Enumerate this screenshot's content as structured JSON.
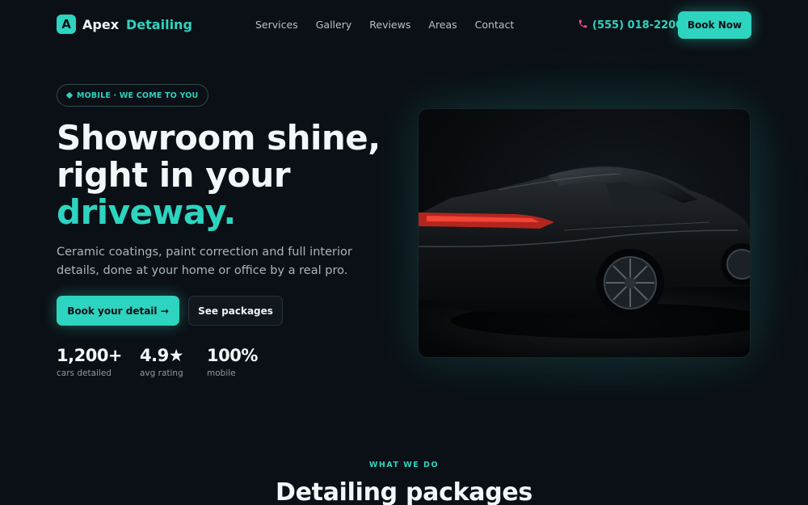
{
  "brand": {
    "mark": "A",
    "word1": "Apex",
    "word2": "Detailing"
  },
  "nav": [
    "Services",
    "Gallery",
    "Reviews",
    "Areas",
    "Contact"
  ],
  "header": {
    "phone": "(555) 018-2200",
    "book_label": "Book Now"
  },
  "hero": {
    "pill": "MOBILE · WE COME TO YOU",
    "headline_line1": "Showroom shine,",
    "headline_line2": "right in your",
    "headline_accent": "driveway.",
    "subtext": "Ceramic coatings, paint correction and full interior details, done at your home or office by a real pro.",
    "cta_primary": "Book your detail →",
    "cta_secondary": "See packages",
    "stats": [
      {
        "value": "1,200+",
        "label": "cars detailed"
      },
      {
        "value": "4.9★",
        "label": "avg rating"
      },
      {
        "value": "100%",
        "label": "mobile"
      }
    ]
  },
  "section": {
    "eyebrow": "WHAT WE DO",
    "title": "Detailing packages"
  },
  "colors": {
    "accent": "#2dd4bf",
    "background": "#0b1016",
    "phone_icon": "#ec4f7a"
  },
  "icons": {
    "phone": "phone-icon",
    "pill": "diamond-icon"
  }
}
